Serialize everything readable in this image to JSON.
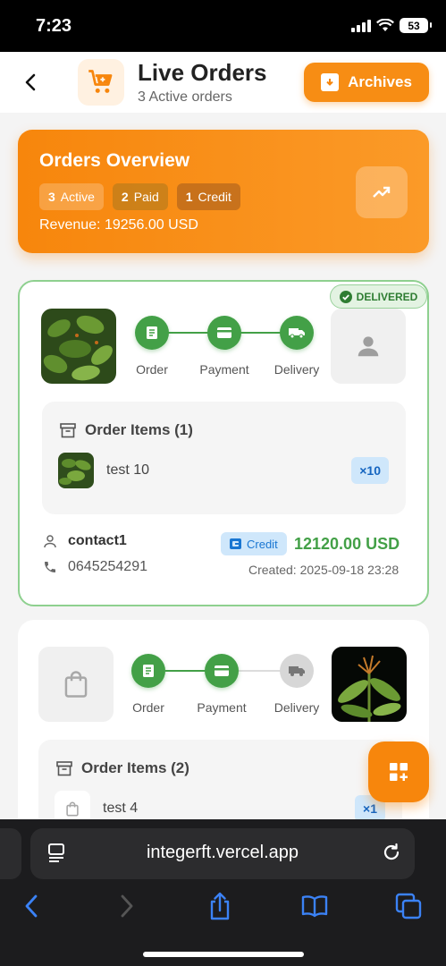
{
  "status_bar": {
    "time": "7:23",
    "battery": "53"
  },
  "header": {
    "title": "Live Orders",
    "subtitle": "3 Active orders",
    "archives_label": "Archives"
  },
  "overview": {
    "title": "Orders Overview",
    "badges": [
      {
        "count": "3",
        "label": "Active"
      },
      {
        "count": "2",
        "label": "Paid"
      },
      {
        "count": "1",
        "label": "Credit"
      }
    ],
    "revenue": "Revenue: 19256.00 USD"
  },
  "orders": [
    {
      "status": "DELIVERED",
      "steps": [
        "Order",
        "Payment",
        "Delivery"
      ],
      "items_header": "Order Items (1)",
      "items": [
        {
          "name": "test 10",
          "qty": "×10"
        }
      ],
      "contact_name": "contact1",
      "phone": "0645254291",
      "payment_tag": "Credit",
      "total": "12120.00 USD",
      "created": "Created: 2025-09-18 23:28"
    },
    {
      "steps": [
        "Order",
        "Payment",
        "Delivery"
      ],
      "items_header": "Order Items (2)",
      "items": [
        {
          "name": "test 4",
          "qty": "×1"
        }
      ]
    }
  ],
  "browser": {
    "url": "integerft.vercel.app"
  },
  "colors": {
    "accent": "#f7860c",
    "success": "#43a047",
    "info": "#1976d2"
  }
}
